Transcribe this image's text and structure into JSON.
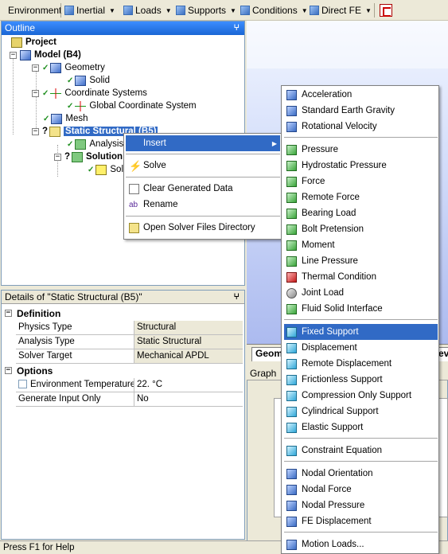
{
  "toolbar": {
    "items": [
      {
        "label": "Environment",
        "has_icon": false,
        "has_caret": false
      },
      {
        "label": "Inertial",
        "icon": "inertial-icon",
        "has_caret": true
      },
      {
        "label": "Loads",
        "icon": "loads-icon",
        "has_caret": true
      },
      {
        "label": "Supports",
        "icon": "supports-icon",
        "has_caret": true
      },
      {
        "label": "Conditions",
        "icon": "conditions-icon",
        "has_caret": true
      },
      {
        "label": "Direct FE",
        "icon": "direct-fe-icon",
        "has_caret": true
      }
    ],
    "caret": "▼"
  },
  "outline": {
    "title": "Outline",
    "pin": "ⵖ",
    "nodes": [
      {
        "label": "Project",
        "icon": "project-icon",
        "bold": true
      },
      {
        "label": "Model (B4)",
        "icon": "model-icon",
        "bold": true,
        "expander": "−"
      },
      {
        "label": "Geometry",
        "icon": "geometry-icon",
        "expander": "−"
      },
      {
        "label": "Solid",
        "icon": "solid-body-icon"
      },
      {
        "label": "Coordinate Systems",
        "icon": "coordinate-systems-icon",
        "expander": "−"
      },
      {
        "label": "Global Coordinate System",
        "icon": "global-coordinate-icon"
      },
      {
        "label": "Mesh",
        "icon": "mesh-icon"
      },
      {
        "label": "Static Structural (B5)",
        "icon": "static-structural-icon",
        "bold": true,
        "selected": true,
        "expander": "−",
        "status": "?"
      },
      {
        "label": "Analysis",
        "icon": "analysis-settings-icon"
      },
      {
        "label": "Solution",
        "icon": "solution-icon",
        "bold": true,
        "expander": "−",
        "status": "?"
      },
      {
        "label": "Sol",
        "icon": "solution-information-icon"
      }
    ]
  },
  "context_menu": {
    "items": [
      {
        "label": "Insert",
        "icon": "",
        "highlighted": true,
        "submenu_arrow": "▶"
      },
      {
        "label": "Solve",
        "icon": "solve-icon"
      },
      {
        "label": "Clear Generated Data",
        "icon": "clear-data-icon"
      },
      {
        "label": "Rename",
        "icon": "rename-icon"
      },
      {
        "label": "Open Solver Files Directory",
        "icon": "folder-icon"
      }
    ]
  },
  "insert_submenu": {
    "groups": [
      [
        {
          "label": "Acceleration",
          "icon": "acceleration-icon",
          "color": "blue"
        },
        {
          "label": "Standard Earth Gravity",
          "icon": "gravity-icon",
          "color": "blue"
        },
        {
          "label": "Rotational Velocity",
          "icon": "rotational-velocity-icon",
          "color": "blue"
        }
      ],
      [
        {
          "label": "Pressure",
          "icon": "pressure-icon",
          "color": "green"
        },
        {
          "label": "Hydrostatic Pressure",
          "icon": "hydrostatic-pressure-icon",
          "color": "green"
        },
        {
          "label": "Force",
          "icon": "force-icon",
          "color": "green"
        },
        {
          "label": "Remote Force",
          "icon": "remote-force-icon",
          "color": "green"
        },
        {
          "label": "Bearing Load",
          "icon": "bearing-load-icon",
          "color": "green"
        },
        {
          "label": "Bolt Pretension",
          "icon": "bolt-pretension-icon",
          "color": "green"
        },
        {
          "label": "Moment",
          "icon": "moment-icon",
          "color": "green"
        },
        {
          "label": "Line Pressure",
          "icon": "line-pressure-icon",
          "color": "green"
        },
        {
          "label": "Thermal Condition",
          "icon": "thermal-condition-icon",
          "color": "red"
        },
        {
          "label": "Joint Load",
          "icon": "joint-load-icon",
          "color": "gray"
        },
        {
          "label": "Fluid Solid Interface",
          "icon": "fluid-solid-interface-icon",
          "color": "green"
        }
      ],
      [
        {
          "label": "Fixed Support",
          "icon": "fixed-support-icon",
          "color": "cyan",
          "highlighted": true
        },
        {
          "label": "Displacement",
          "icon": "displacement-icon",
          "color": "cyan"
        },
        {
          "label": "Remote Displacement",
          "icon": "remote-displacement-icon",
          "color": "cyan"
        },
        {
          "label": "Frictionless Support",
          "icon": "frictionless-support-icon",
          "color": "cyan"
        },
        {
          "label": "Compression Only Support",
          "icon": "compression-only-support-icon",
          "color": "cyan"
        },
        {
          "label": "Cylindrical Support",
          "icon": "cylindrical-support-icon",
          "color": "cyan"
        },
        {
          "label": "Elastic Support",
          "icon": "elastic-support-icon",
          "color": "cyan"
        }
      ],
      [
        {
          "label": "Constraint Equation",
          "icon": "constraint-equation-icon",
          "color": "cyan"
        }
      ],
      [
        {
          "label": "Nodal Orientation",
          "icon": "nodal-orientation-icon",
          "color": "blue"
        },
        {
          "label": "Nodal Force",
          "icon": "nodal-force-icon",
          "color": "blue"
        },
        {
          "label": "Nodal Pressure",
          "icon": "nodal-pressure-icon",
          "color": "blue"
        },
        {
          "label": "FE Displacement",
          "icon": "fe-displacement-icon",
          "color": "blue"
        }
      ],
      [
        {
          "label": "Motion Loads...",
          "icon": "motion-loads-icon",
          "color": "blue"
        }
      ]
    ]
  },
  "details": {
    "title": "Details of \"Static Structural (B5)\"",
    "pin": "ⵖ",
    "groups": [
      {
        "name": "Definition",
        "expander": "−",
        "rows": [
          {
            "name": "Physics Type",
            "value": "Structural"
          },
          {
            "name": "Analysis Type",
            "value": "Static Structural"
          },
          {
            "name": "Solver Target",
            "value": "Mechanical APDL"
          }
        ]
      },
      {
        "name": "Options",
        "expander": "−",
        "rows": [
          {
            "name": "Environment Temperature",
            "value": "22. °C",
            "checkbox": true
          },
          {
            "name": "Generate Input Only",
            "value": "No"
          }
        ]
      }
    ]
  },
  "viewport": {
    "tabs": [
      "Geom",
      "ev"
    ]
  },
  "graph": {
    "title": "Graph"
  },
  "status_bar": {
    "text": "Press F1 for Help"
  },
  "colors": {
    "selection": "#316ac5",
    "title_bar": "#1a66d4",
    "chrome": "#ece9d8"
  }
}
